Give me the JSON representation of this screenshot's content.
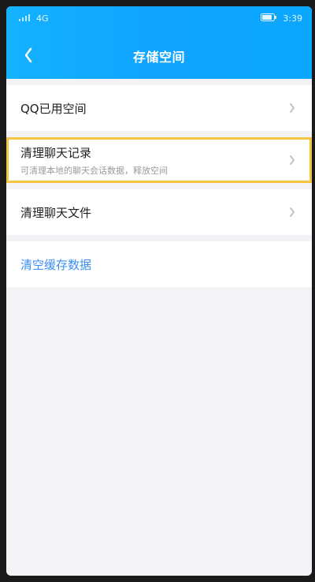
{
  "status": {
    "left_text": "4G",
    "time": "3:39"
  },
  "header": {
    "title": "存储空间"
  },
  "items": {
    "qq_used": {
      "label": "QQ已用空间"
    },
    "chat_history": {
      "label": "清理聊天记录",
      "subtext": "可清理本地的聊天会话数据，释放空间"
    },
    "chat_files": {
      "label": "清理聊天文件"
    }
  },
  "actions": {
    "clear_cache": "清空缓存数据"
  },
  "colors": {
    "header_start": "#14b2ff",
    "header_end": "#0aa6ff",
    "highlight": "#f5c542",
    "link_blue": "#3a8ef3"
  }
}
